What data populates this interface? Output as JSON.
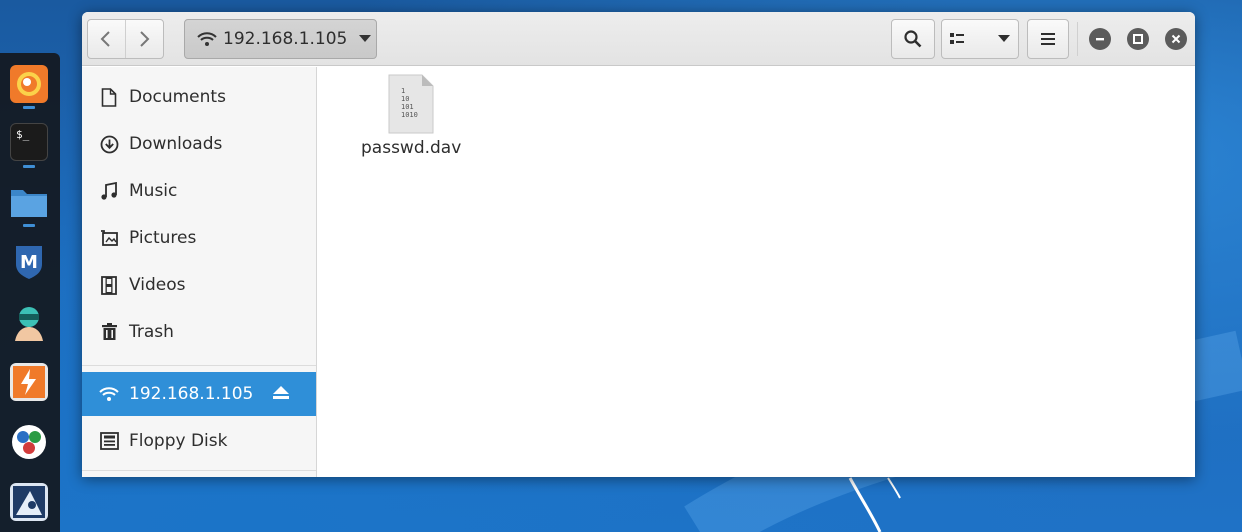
{
  "toolbar": {
    "back_icon": "chevron-left-icon",
    "forward_icon": "chevron-right-icon",
    "location_icon": "network-wifi-icon",
    "location_label": "192.168.1.105",
    "location_dropdown_icon": "triangle-down-icon",
    "search_icon": "search-icon",
    "view_icon": "list-view-icon",
    "view_dropdown_icon": "triangle-down-icon",
    "menu_icon": "hamburger-icon",
    "window_controls": [
      "minimize-icon",
      "maximize-icon",
      "close-icon"
    ]
  },
  "sidebar": {
    "items": [
      {
        "label": "Documents",
        "icon": "document-icon"
      },
      {
        "label": "Downloads",
        "icon": "download-icon"
      },
      {
        "label": "Music",
        "icon": "music-icon"
      },
      {
        "label": "Pictures",
        "icon": "picture-icon"
      },
      {
        "label": "Videos",
        "icon": "film-icon"
      },
      {
        "label": "Trash",
        "icon": "trash-icon"
      }
    ],
    "network": {
      "label": "192.168.1.105",
      "icon": "network-wifi-icon",
      "eject_icon": "eject-icon",
      "selected": true
    },
    "devices": [
      {
        "label": "Floppy Disk",
        "icon": "floppy-disk-icon"
      }
    ]
  },
  "content": {
    "files": [
      {
        "name": "passwd.dav",
        "icon": "binary-file-icon",
        "icon_text": [
          "1",
          "10",
          "101",
          "1010"
        ]
      }
    ]
  },
  "dock": {
    "apps": [
      "firefox-icon",
      "terminal-icon",
      "files-icon",
      "metasploit-icon",
      "armitage-icon",
      "burpsuite-icon",
      "app-circle-icon",
      "kali-tool-icon"
    ]
  },
  "colors": {
    "selection": "#2f8fd8",
    "desktop": "#1e6cbd",
    "dock": "#14181e"
  }
}
